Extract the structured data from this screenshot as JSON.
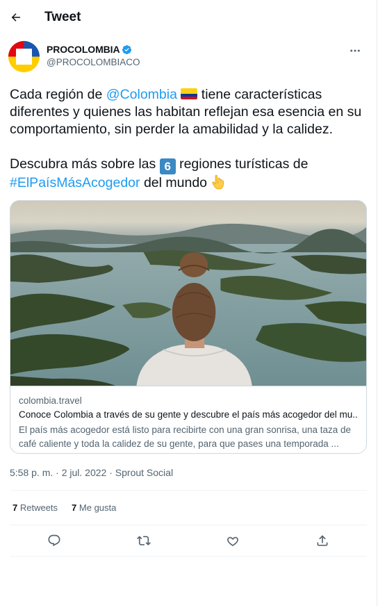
{
  "header": {
    "title": "Tweet"
  },
  "author": {
    "name": "PROCOLOMBIA",
    "handle": "@PROCOLOMBIACO",
    "verified": true
  },
  "tweet": {
    "p1_start": "Cada región de ",
    "mention": "@Colombia",
    "p1_rest": " tiene características diferentes y quienes las habitan reflejan esa esencia en su comportamiento, sin perder la amabilidad y la calidez.",
    "p2_start": "Descubra más sobre las ",
    "keycap": "6",
    "p2_mid": " regiones turísticas de ",
    "hashtag": "#ElPaísMásAcogedor",
    "p2_end": " del mundo "
  },
  "card": {
    "domain": "colombia.travel",
    "title": "Conoce Colombia a través de su gente y descubre el país más acogedor del mu...",
    "description": "El país más acogedor está listo para recibirte con una gran sonrisa, una taza de café caliente y toda la calidez de su gente, para que pases una temporada ..."
  },
  "meta": {
    "time": "5:58 p. m.",
    "separator": " · ",
    "date": "2 jul. 2022",
    "source": "Sprout Social"
  },
  "stats": {
    "retweets_count": "7",
    "retweets_label": " Retweets",
    "likes_count": "7",
    "likes_label": " Me gusta"
  },
  "icons": {
    "back": "arrow-left-icon",
    "more": "more-horizontal-icon",
    "reply": "reply-icon",
    "retweet": "retweet-icon",
    "like": "heart-icon",
    "share": "share-icon"
  },
  "colors": {
    "accent": "#1d9bf0",
    "text": "#0f1419",
    "secondary": "#536471",
    "border": "#cfd9de"
  }
}
